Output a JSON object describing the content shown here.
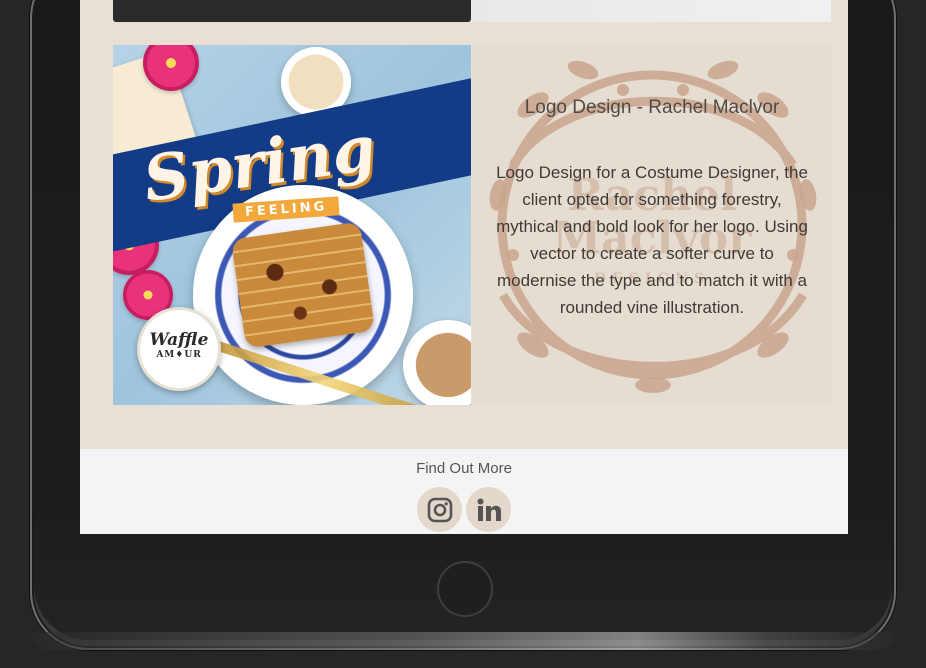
{
  "portfolio": {
    "tiles": [
      {
        "type": "image",
        "artwork": {
          "headline": "Spring",
          "tagline": "FEELING",
          "brand_line1": "Waffle",
          "brand_line2": "AM♦UR"
        }
      },
      {
        "type": "text",
        "title": "Logo Design - Rachel Maclvor",
        "body": "Logo Design for a Costume Designer, the client opted for something forestry, mythical and bold look for her logo. Using vector to create a softer curve to modernise the type and to match it with a rounded vine illustration."
      }
    ]
  },
  "footer": {
    "heading": "Find Out More",
    "social": [
      {
        "icon": "instagram-icon"
      },
      {
        "icon": "linkedin-icon"
      }
    ]
  },
  "colors": {
    "page_bg": "#e8e0d5",
    "footer_bg": "#f4f4f4",
    "social_bg": "#e3d8cb",
    "vine": "#c9a58e"
  }
}
